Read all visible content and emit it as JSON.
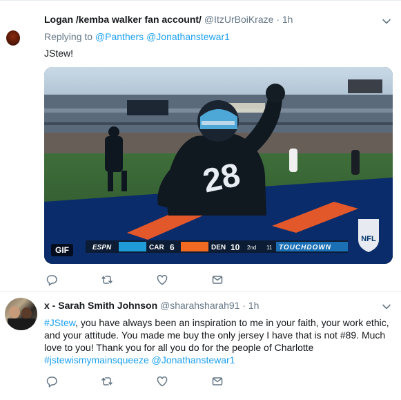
{
  "tweets": [
    {
      "name": "Logan /kemba walker fan account/",
      "handle": "@ItzUrBoiKraze",
      "separator": "·",
      "time": "1h",
      "replying_prefix": "Replying to",
      "reply_to": [
        "@Panthers",
        "@Jonathanstewar1"
      ],
      "text": "JStew!",
      "media": {
        "badge": "GIF",
        "scoreboard": {
          "network": "ESPN",
          "team1": "CAR",
          "score1": "6",
          "team2": "DEN",
          "score2": "10",
          "down": "2nd",
          "clock": "11",
          "banner": "TOUCHDOWN"
        },
        "jersey_number": "28",
        "league_logo": "NFL"
      }
    },
    {
      "name": "x - Sarah Smith Johnson",
      "handle": "@sharahsharah91",
      "separator": "·",
      "time": "1h",
      "hashtag_start": "#JStew",
      "body_part1": ", you have always been an inspiration to me in your faith, your work ethic, and your attitude. You made me buy the only jersey I have that is not #89. Much love to you! Thank you for all you do for the people of Charlotte",
      "hashtag_end": "#jstewismymainsqueeze",
      "mention_end": "@Jonathanstewar1"
    }
  ],
  "icons": [
    "reply-icon",
    "retweet-icon",
    "like-icon",
    "dm-icon",
    "caret-down-icon"
  ],
  "colors": {
    "link": "#1da1f2",
    "muted": "#657786",
    "text": "#14171a",
    "divider": "#e6ecf0"
  }
}
